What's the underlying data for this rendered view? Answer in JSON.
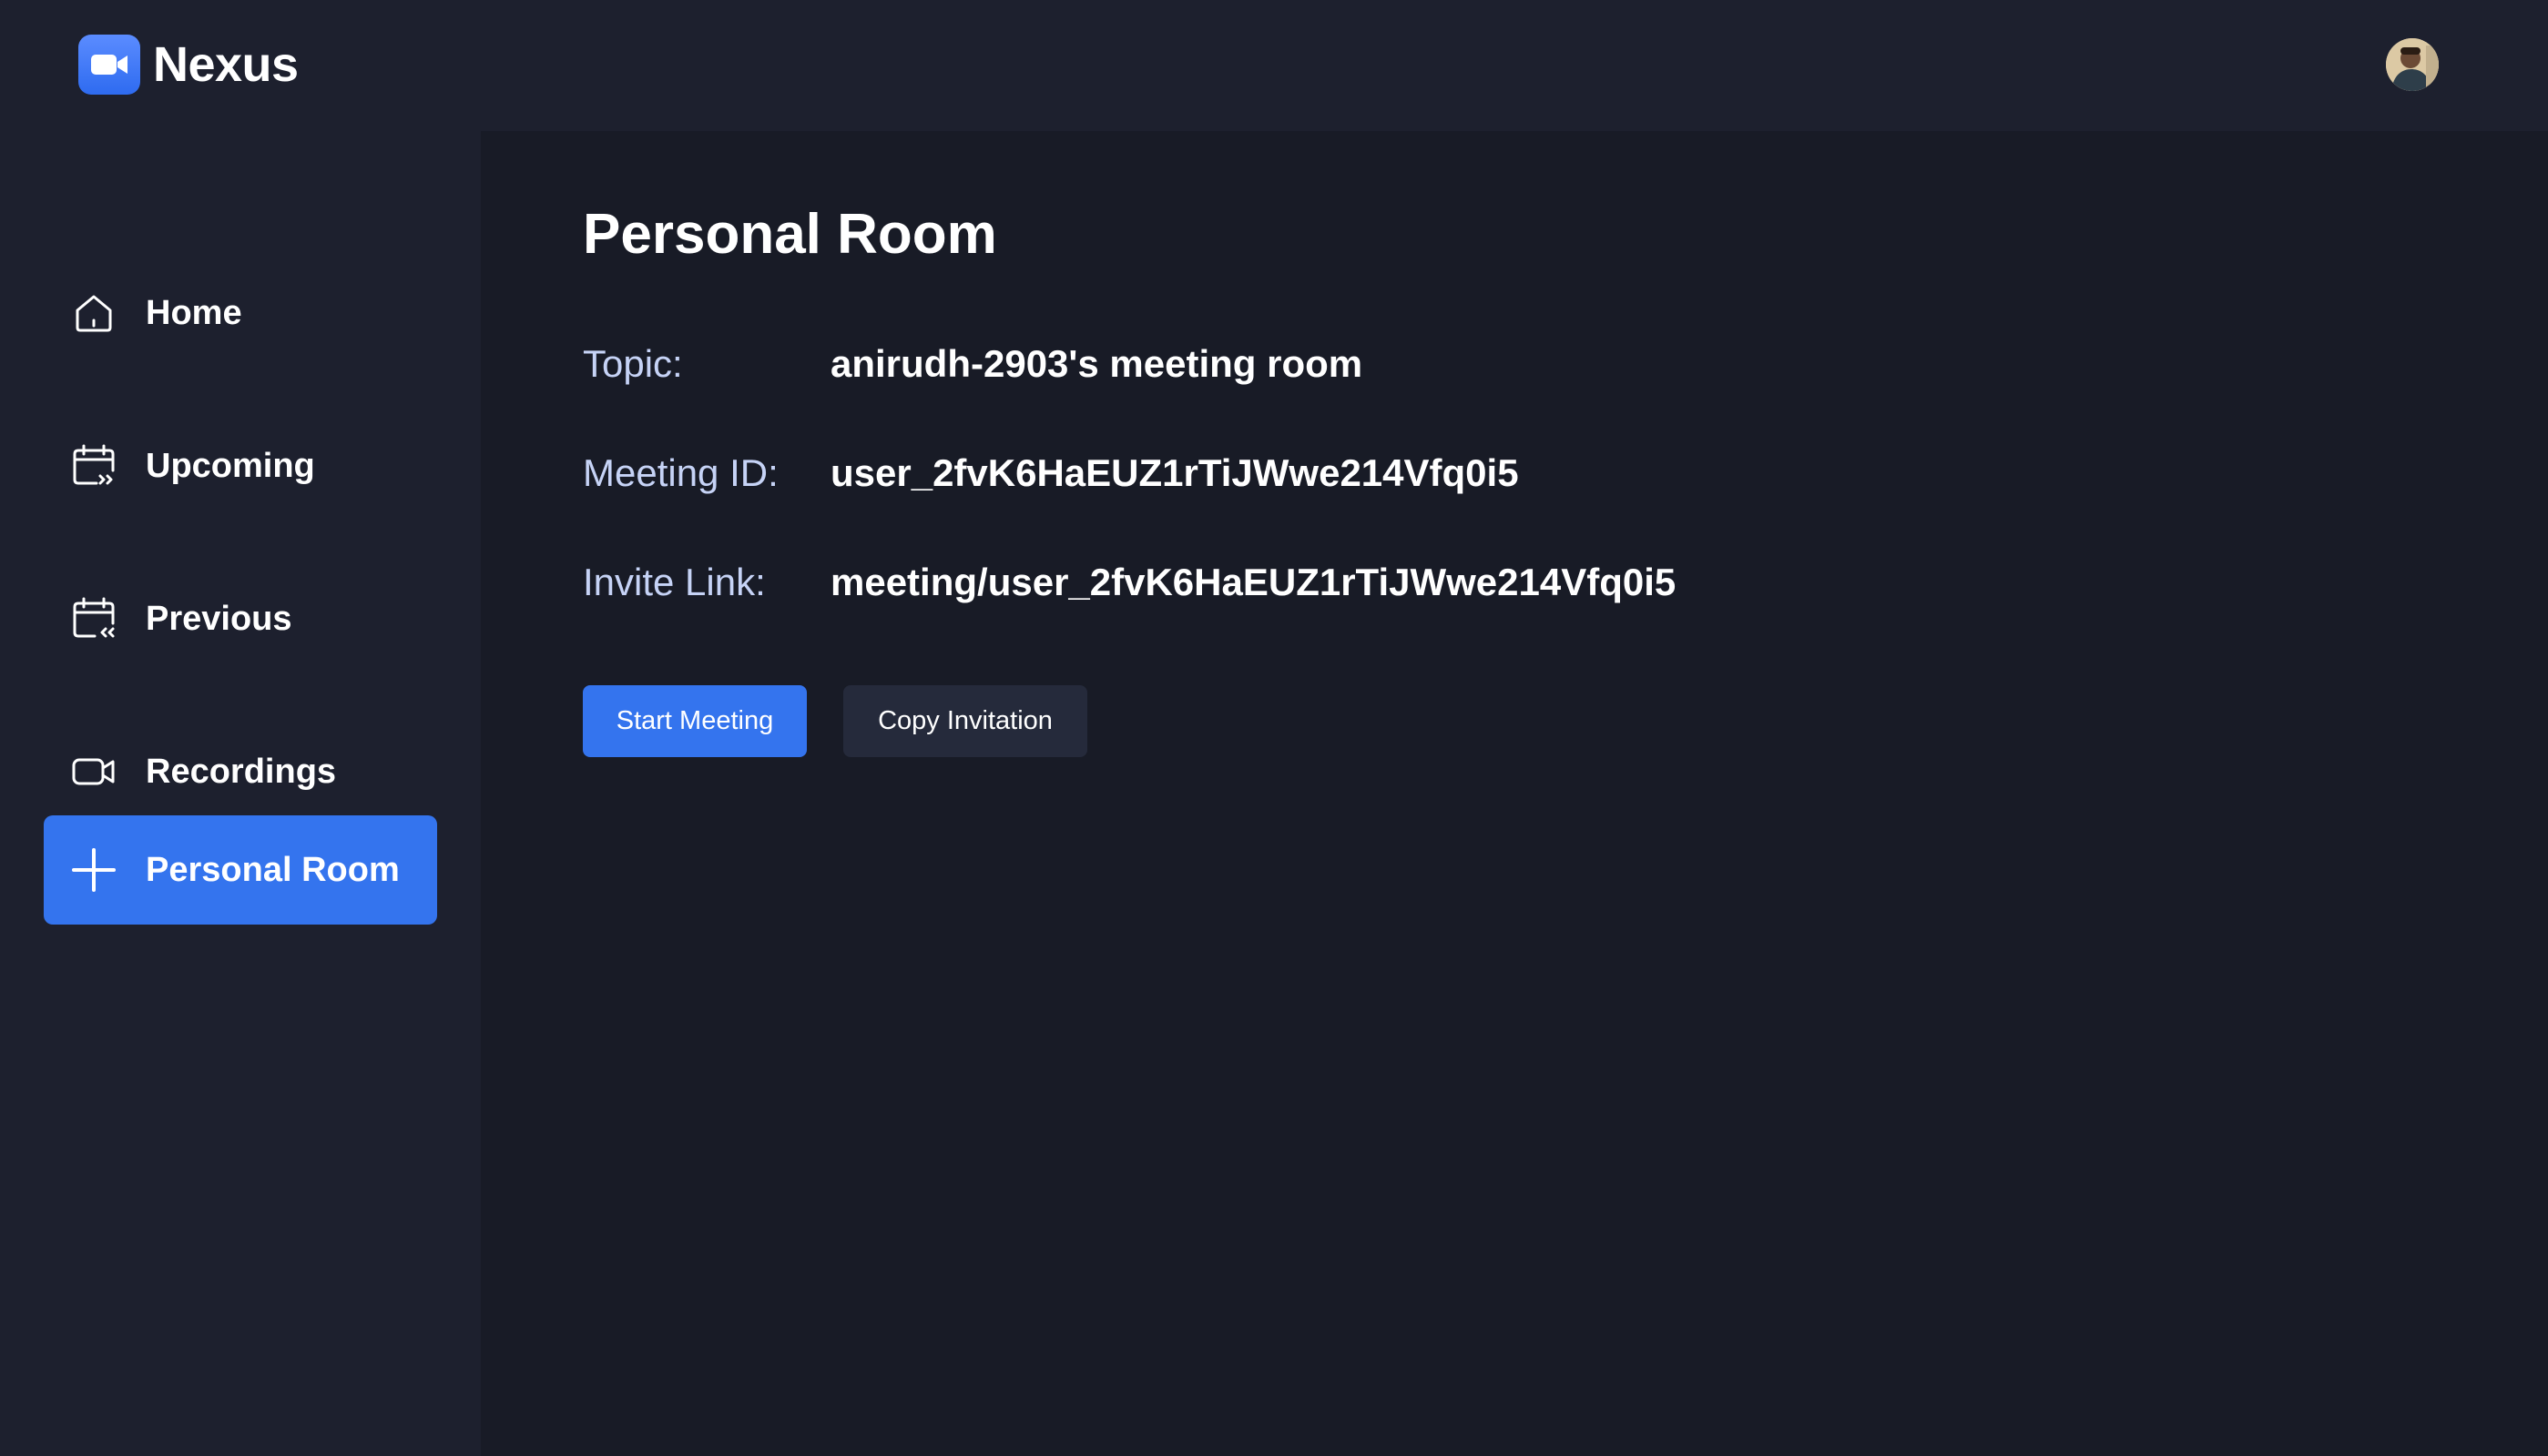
{
  "app": {
    "name": "Nexus"
  },
  "sidebar": {
    "items": [
      {
        "label": "Home",
        "icon": "home-icon",
        "active": false
      },
      {
        "label": "Upcoming",
        "icon": "calendar-upcoming-icon",
        "active": false
      },
      {
        "label": "Previous",
        "icon": "calendar-previous-icon",
        "active": false
      },
      {
        "label": "Recordings",
        "icon": "video-icon",
        "active": false
      },
      {
        "label": "Personal Room",
        "icon": "plus-icon",
        "active": true
      }
    ]
  },
  "main": {
    "title": "Personal Room",
    "fields": [
      {
        "label": "Topic:",
        "value": "anirudh-2903's meeting room"
      },
      {
        "label": "Meeting ID:",
        "value": "user_2fvK6HaEUZ1rTiJWwe214Vfq0i5"
      },
      {
        "label": "Invite Link:",
        "value": "meeting/user_2fvK6HaEUZ1rTiJWwe214Vfq0i5"
      }
    ],
    "buttons": {
      "start": "Start Meeting",
      "copy": "Copy Invitation"
    }
  },
  "colors": {
    "accent": "#3474ee",
    "sidebar_bg": "#1d202e",
    "main_bg": "#181b26",
    "label": "#c6d3f6"
  }
}
